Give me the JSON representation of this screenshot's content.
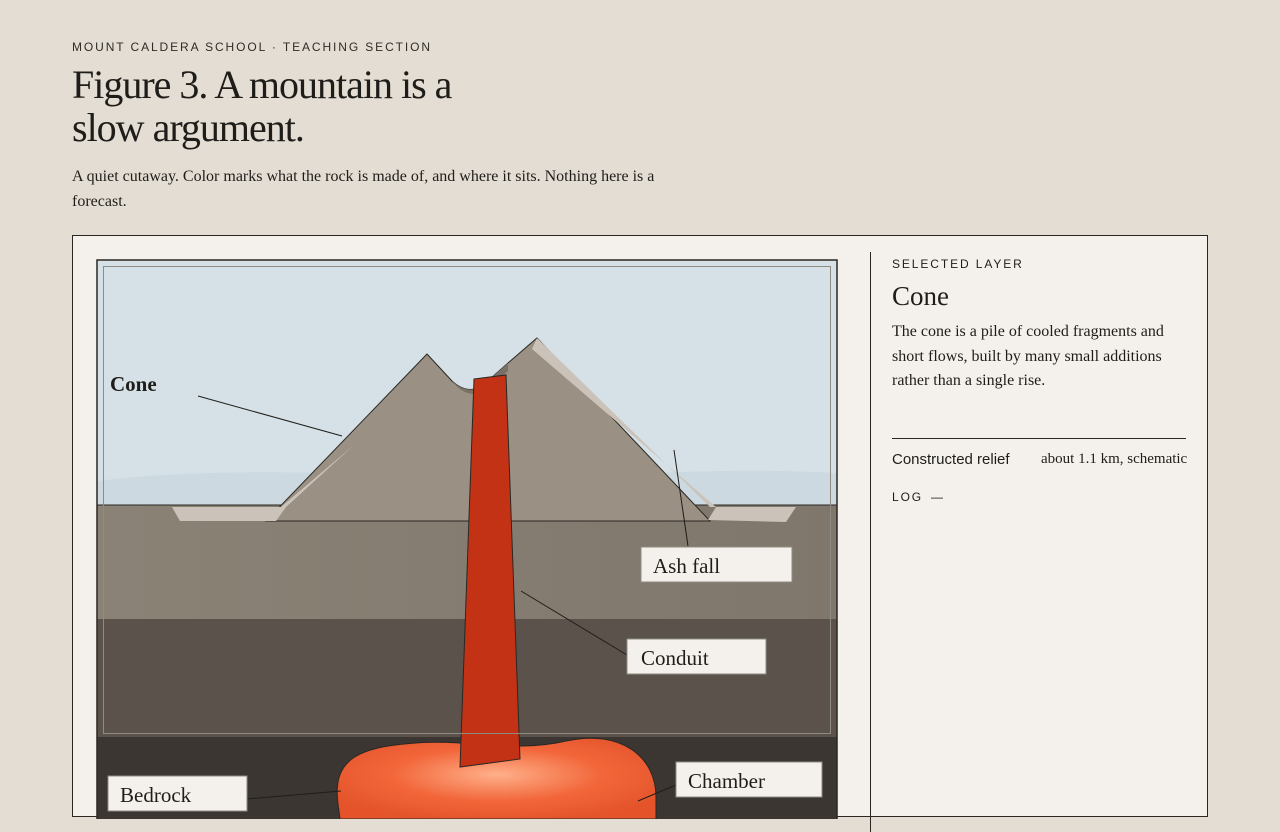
{
  "header": {
    "eyebrow": "MOUNT CALDERA SCHOOL · TEACHING SECTION",
    "title": "Figure 3. A mountain is a slow argument.",
    "subtitle": "A quiet cutaway. Color marks what the rock is made of, and where it sits. Nothing here is a forecast."
  },
  "figure": {
    "labels": {
      "cone": "Cone",
      "ash_fall": "Ash fall",
      "conduit": "Conduit",
      "bedrock": "Bedrock",
      "chamber": "Chamber"
    },
    "colors": {
      "sky": "#d5e1e6",
      "cone": "#9a9184",
      "ash": "#cbc3ba",
      "upper_layer": "#867d71",
      "middle_layer": "#5b534b",
      "bedrock": "#3b3631",
      "conduit": "#c43216",
      "chamber": "#f2663a"
    }
  },
  "sidebar": {
    "eyebrow": "SELECTED LAYER",
    "title": "Cone",
    "description": "The cone is a pile of cooled fragments and short flows, built by many small additions rather than a single rise.",
    "meta_key": "Constructed relief",
    "meta_value": "about 1.1 km, schematic",
    "log_label": "LOG",
    "log_value": "—"
  }
}
